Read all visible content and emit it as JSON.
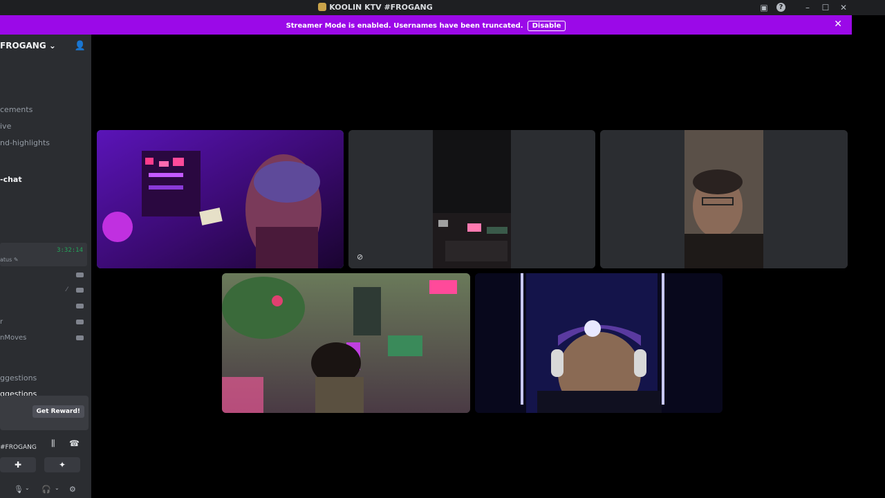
{
  "window": {
    "title": "KOOLIN KTV #FROGANG",
    "controls": [
      "minimize",
      "maximize",
      "close"
    ]
  },
  "banner": {
    "message": "Streamer Mode is enabled. Usernames have been truncated.",
    "button_label": "Disable"
  },
  "sidebar": {
    "server_name": "FROGANG",
    "channels": [
      {
        "label": "cements"
      },
      {
        "label": "ive"
      },
      {
        "label": "nd-highlights"
      },
      {
        "label": "-chat",
        "active": true
      }
    ],
    "voice": {
      "timer": "3:32:14",
      "status": "atus"
    },
    "members": [
      {
        "label": ""
      },
      {
        "label": ""
      },
      {
        "label": ""
      },
      {
        "label": "r"
      },
      {
        "label": "nMoves"
      }
    ],
    "lower_channels": [
      {
        "label": "ggestions"
      },
      {
        "label": "ggestions"
      }
    ],
    "reward_button": "Get Reward!",
    "voice_connection": "#FROGANG"
  },
  "icons": {
    "add_user": "add-user-icon",
    "soundboard": "waveform-icon",
    "disconnect": "phone-hangup-icon",
    "activities": "activities-icon",
    "effects": "effects-icon",
    "mic": "microphone-icon",
    "headset": "headset-icon",
    "settings": "gear-icon"
  },
  "colors": {
    "banner": "#9b09e8",
    "speaking": "#23a55a",
    "sidebar": "#2b2d31"
  }
}
